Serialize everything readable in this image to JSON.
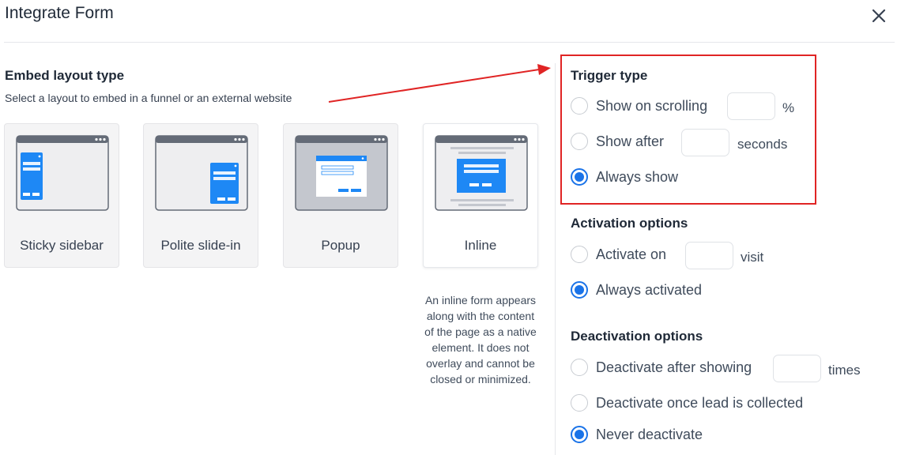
{
  "header": {
    "title": "Integrate Form",
    "close_icon": "close-icon"
  },
  "embed": {
    "title": "Embed layout type",
    "subtitle": "Select a layout to embed in a funnel or an external website",
    "layouts": [
      {
        "label": "Sticky sidebar",
        "selected": false
      },
      {
        "label": "Polite slide-in",
        "selected": false
      },
      {
        "label": "Popup",
        "selected": false
      },
      {
        "label": "Inline",
        "selected": true
      }
    ],
    "inline_description": "An inline form appears along with the content of the page as a native element. It does not overlay and cannot be closed or minimized."
  },
  "trigger": {
    "title": "Trigger type",
    "options": [
      {
        "label": "Show on scrolling",
        "checked": false,
        "input_value": "",
        "unit": "%"
      },
      {
        "label": "Show after",
        "checked": false,
        "input_value": "",
        "unit": "seconds"
      },
      {
        "label": "Always show",
        "checked": true
      }
    ]
  },
  "activation": {
    "title": "Activation options",
    "options": [
      {
        "label": "Activate on",
        "checked": false,
        "input_value": "",
        "unit": "visit"
      },
      {
        "label": "Always activated",
        "checked": true
      }
    ]
  },
  "deactivation": {
    "title": "Deactivation options",
    "options": [
      {
        "label": "Deactivate after showing",
        "checked": false,
        "input_value": "",
        "unit": "times"
      },
      {
        "label": "Deactivate once lead is collected",
        "checked": false
      },
      {
        "label": "Never deactivate",
        "checked": true
      }
    ]
  },
  "colors": {
    "accent": "#1a73e8",
    "highlight": "#e02424",
    "card_blue": "#1e88f5"
  }
}
